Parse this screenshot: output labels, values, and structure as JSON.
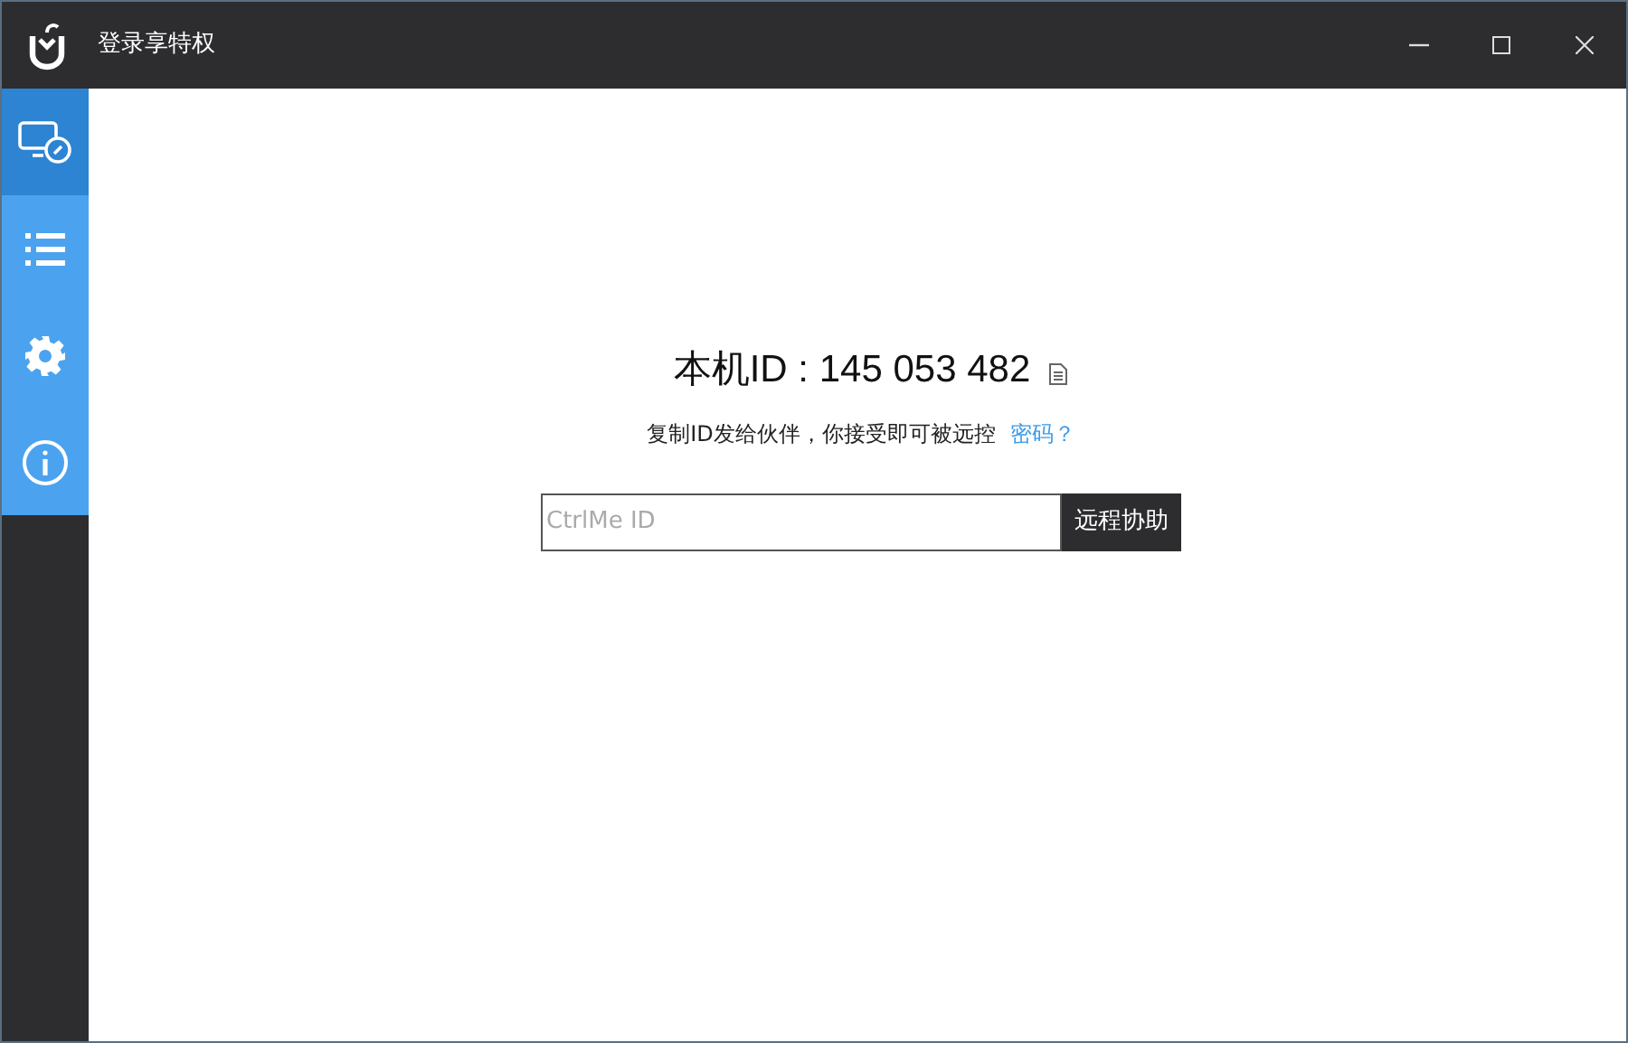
{
  "window": {
    "title": "登录享特权"
  },
  "sidebar": {
    "items": [
      {
        "kind": "remote",
        "selected": true
      },
      {
        "kind": "list",
        "selected": false
      },
      {
        "kind": "settings",
        "selected": false
      },
      {
        "kind": "info",
        "selected": false
      }
    ]
  },
  "main": {
    "machine_id": "本机ID : 145 053 482",
    "hint": "复制ID发给伙伴，你接受即可被远控",
    "password_link": "密码？",
    "id_input": {
      "placeholder": "CtrlMe ID"
    },
    "connect_button": "远程协助"
  }
}
